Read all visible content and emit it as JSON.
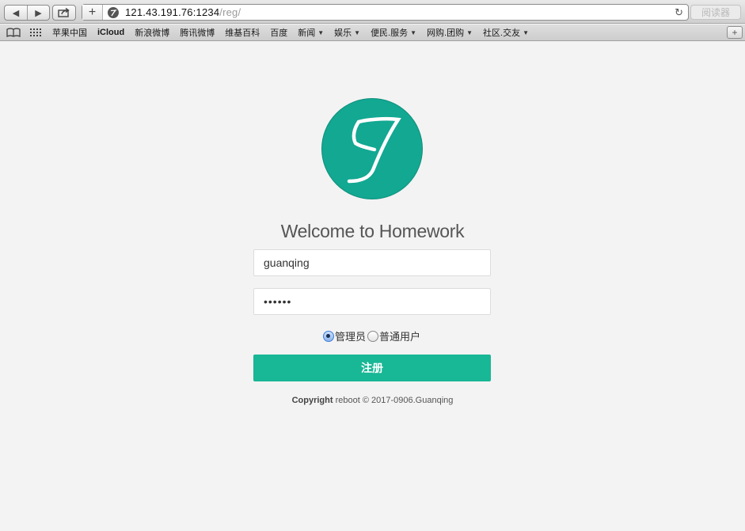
{
  "browser": {
    "url_host": "121.43.191.76:1234",
    "url_path": "/reg/",
    "reader_label": "阅读器",
    "bookmarks": [
      {
        "label": "苹果中国",
        "menu": false
      },
      {
        "label": "iCloud",
        "menu": false
      },
      {
        "label": "新浪微博",
        "menu": false
      },
      {
        "label": "腾讯微博",
        "menu": false
      },
      {
        "label": "维基百科",
        "menu": false
      },
      {
        "label": "百度",
        "menu": false
      },
      {
        "label": "新闻",
        "menu": true
      },
      {
        "label": "娱乐",
        "menu": true
      },
      {
        "label": "便民.服务",
        "menu": true
      },
      {
        "label": "网购.团购",
        "menu": true
      },
      {
        "label": "社区.交友",
        "menu": true
      }
    ]
  },
  "page": {
    "welcome": "Welcome to Homework",
    "username_value": "guanqing",
    "password_value": "••••••",
    "roles": [
      {
        "label": "管理员",
        "selected": true
      },
      {
        "label": "普通用户",
        "selected": false
      }
    ],
    "submit_label": "注册",
    "footer_bold": "Copyright",
    "footer_text": " reboot © 2017-0906.Guanqing"
  },
  "colors": {
    "brand": "#12a892",
    "button": "#18b795",
    "background": "#f3f3f3"
  }
}
